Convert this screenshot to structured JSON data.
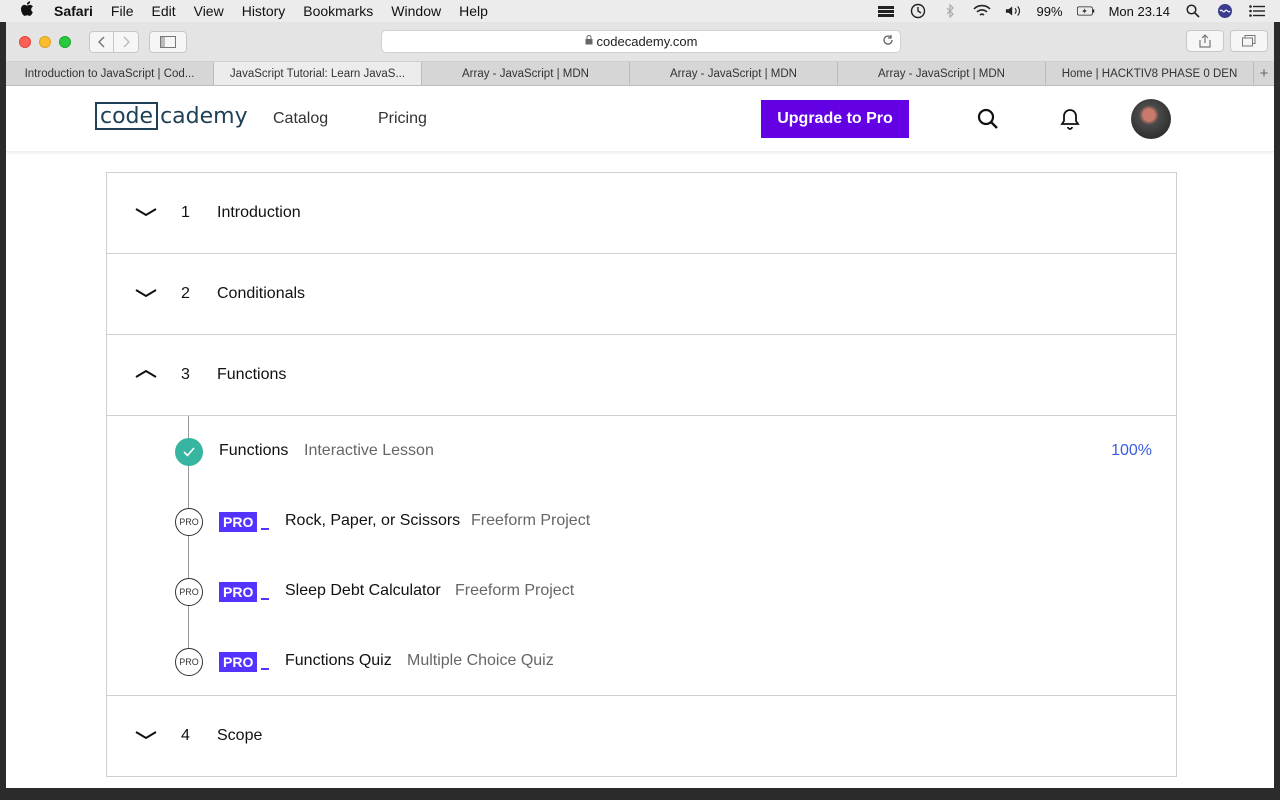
{
  "menubar": {
    "app_name": "Safari",
    "items": [
      "File",
      "Edit",
      "View",
      "History",
      "Bookmarks",
      "Window",
      "Help"
    ],
    "battery": "99%",
    "clock": "Mon 23.14"
  },
  "browser": {
    "url": "codecademy.com",
    "tabs": [
      "Introduction to JavaScript | Cod...",
      "JavaScript Tutorial: Learn JavaS...",
      "Array - JavaScript | MDN",
      "Array - JavaScript | MDN",
      "Array - JavaScript | MDN",
      "Home | HACKTIV8 PHASE 0 DEN"
    ],
    "active_tab": 1
  },
  "header": {
    "logo_box": "code",
    "logo_rest": "cademy",
    "nav": [
      "Catalog",
      "Pricing"
    ],
    "upgrade_label": "Upgrade to Pro"
  },
  "modules": [
    {
      "num": "1",
      "title": "Introduction",
      "expanded": false
    },
    {
      "num": "2",
      "title": "Conditionals",
      "expanded": false
    },
    {
      "num": "3",
      "title": "Functions",
      "expanded": true
    },
    {
      "num": "4",
      "title": "Scope",
      "expanded": false
    }
  ],
  "lessons": [
    {
      "name": "Functions",
      "type": "Interactive Lesson",
      "progress": "100%",
      "completed": true,
      "pro": false
    },
    {
      "name": "Rock, Paper, or Scissors",
      "type": "Freeform Project",
      "marker": "PRO",
      "pro": true,
      "badge": "PRO"
    },
    {
      "name": "Sleep Debt Calculator",
      "type": "Freeform Project",
      "marker": "PRO",
      "pro": true,
      "badge": "PRO"
    },
    {
      "name": "Functions Quiz",
      "type": "Multiple Choice Quiz",
      "marker": "PRO",
      "pro": true,
      "badge": "PRO"
    }
  ],
  "colors": {
    "upgrade": "#6400e4",
    "pro_badge": "#5533ff",
    "complete": "#37b5a0",
    "progress_text": "#3a5ce0"
  }
}
